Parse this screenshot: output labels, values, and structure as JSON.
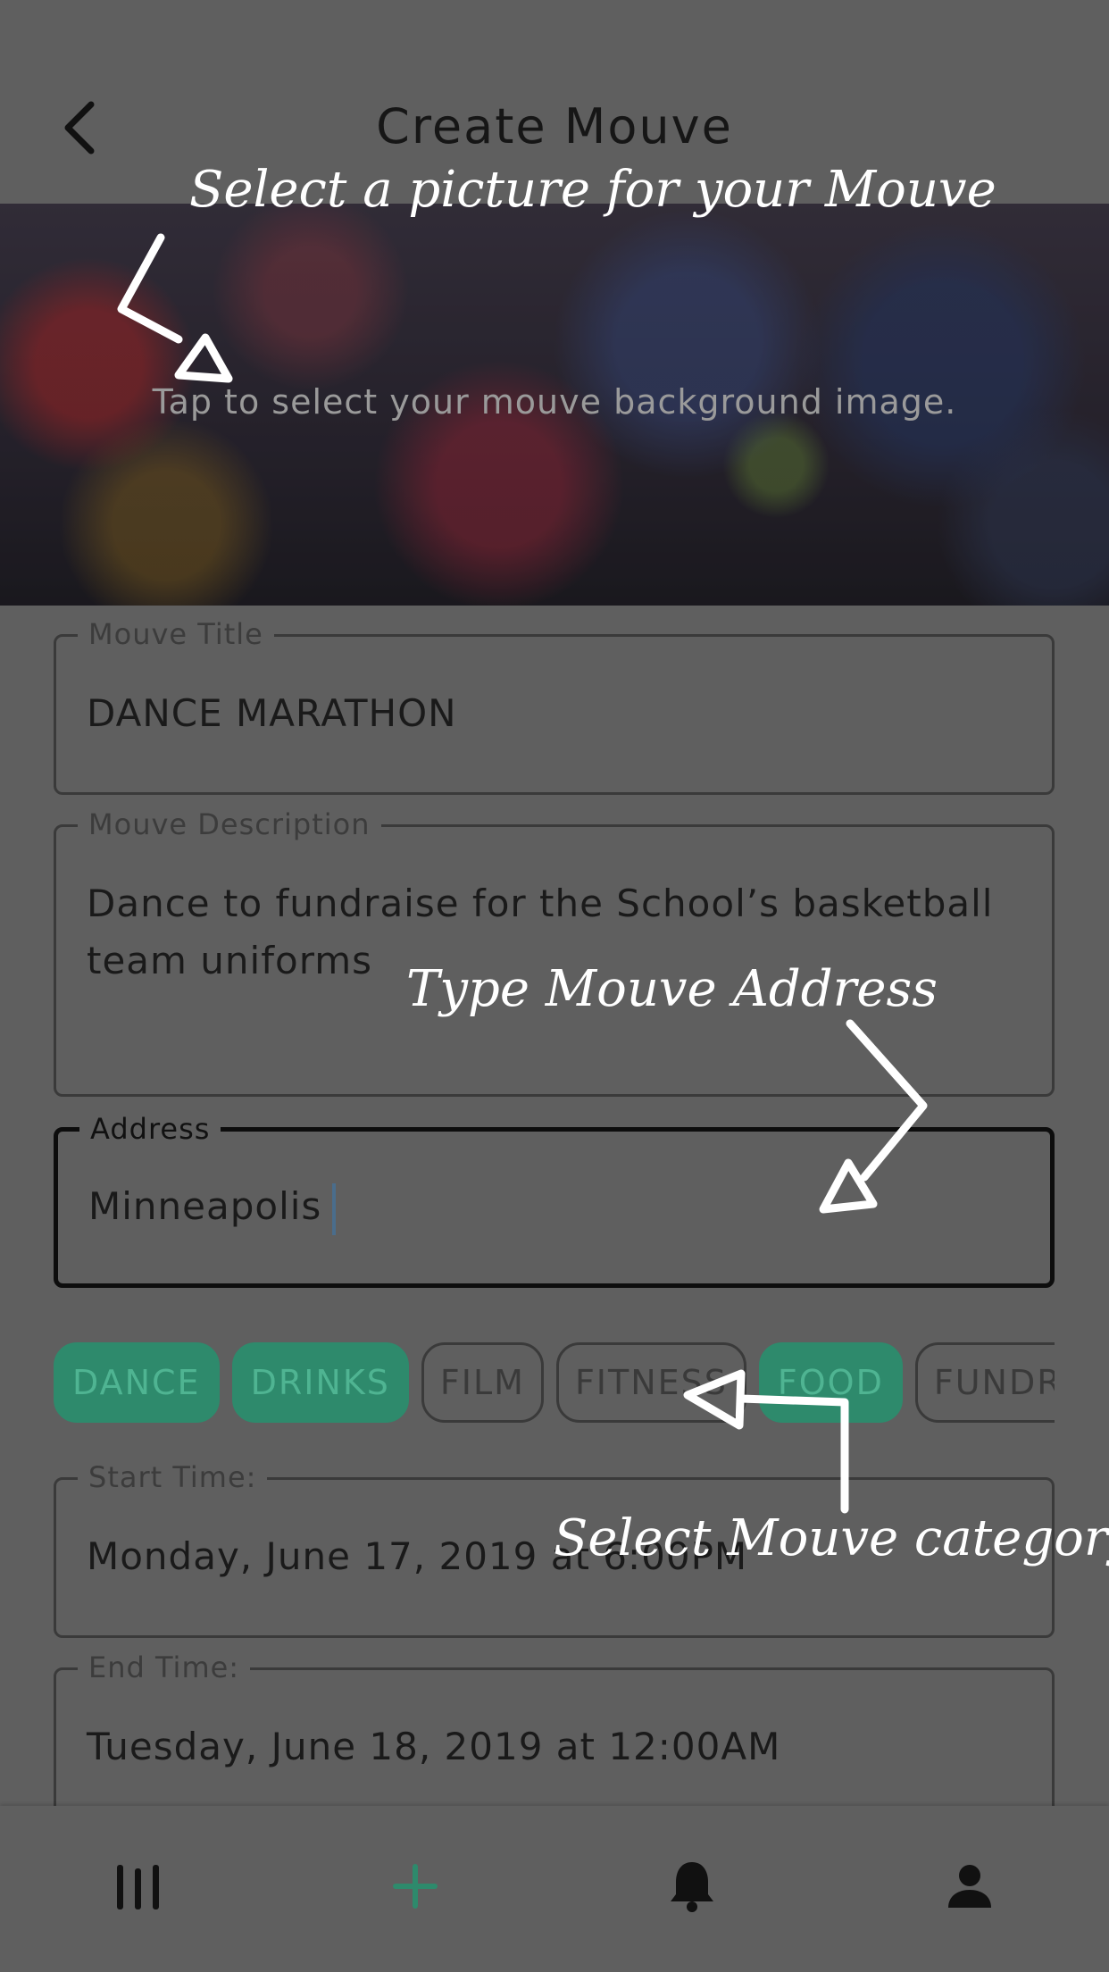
{
  "header": {
    "title": "Create Mouve"
  },
  "hero": {
    "hint": "Tap to select your mouve background image."
  },
  "form": {
    "title": {
      "label": "Mouve Title",
      "value": "DANCE MARATHON"
    },
    "description": {
      "label": "Mouve Description",
      "value": "Dance to fundraise for the School’s basketball team uniforms"
    },
    "address": {
      "label": "Address",
      "value": "Minneapolis"
    },
    "start_time": {
      "label": "Start Time:",
      "value": "Monday, June 17, 2019 at 6:00PM"
    },
    "end_time": {
      "label": "End Time:",
      "value": "Tuesday, June 18, 2019 at 12:00AM"
    }
  },
  "categories": [
    {
      "label": "DANCE",
      "selected": true
    },
    {
      "label": "DRINKS",
      "selected": true
    },
    {
      "label": "FILM",
      "selected": false
    },
    {
      "label": "FITNESS",
      "selected": false
    },
    {
      "label": "FOOD",
      "selected": true
    },
    {
      "label": "FUNDRAISER",
      "selected": false
    }
  ],
  "annotations": {
    "picture": "Select a picture for your Mouve",
    "address": "Type Mouve Address",
    "category": "Select Mouve category"
  },
  "tabbar": {
    "items": [
      {
        "icon": "feed-icon"
      },
      {
        "icon": "plus-icon"
      },
      {
        "icon": "bell-icon"
      },
      {
        "icon": "profile-icon"
      }
    ]
  },
  "colors": {
    "accent": "#2e8a6c",
    "accent_text": "#4fb492",
    "overlay": "#5f5f5f"
  }
}
